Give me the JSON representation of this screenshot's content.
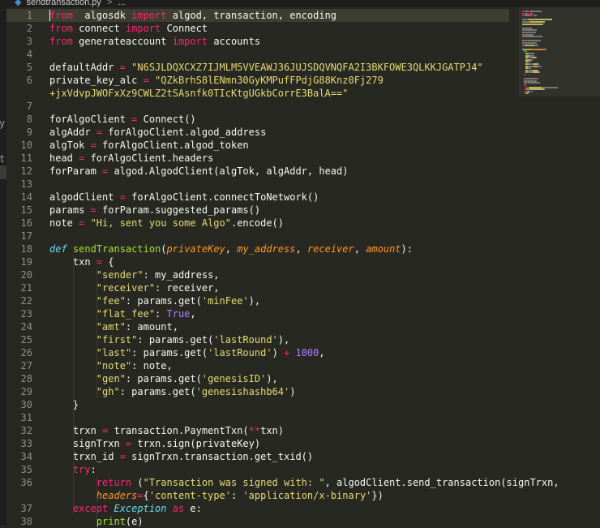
{
  "breadcrumb": {
    "file": "sendtransaction.py",
    "separator": ">",
    "ellipsis": "..."
  },
  "sidebar": {
    "fragments": [
      "y",
      "t"
    ]
  },
  "colors": {
    "background": "#272822",
    "keyword": "#f92672",
    "string": "#e6db74",
    "number": "#ae81ff",
    "function": "#a6e22e",
    "storage": "#66d9ef",
    "parameter": "#fd971f",
    "text": "#f8f8f2",
    "line_number": "#90908a"
  },
  "editor": {
    "lines": [
      {
        "n": "1",
        "t": [
          [
            "kw",
            "from"
          ],
          [
            "",
            "  algosdk "
          ],
          [
            "kw",
            "import"
          ],
          [
            "",
            " algod, transaction, encoding"
          ]
        ]
      },
      {
        "n": "2",
        "t": [
          [
            "kw",
            "from"
          ],
          [
            "",
            " connect "
          ],
          [
            "kw",
            "import"
          ],
          [
            "",
            " Connect"
          ]
        ]
      },
      {
        "n": "3",
        "t": [
          [
            "kw",
            "from"
          ],
          [
            "",
            " generateaccount "
          ],
          [
            "kw",
            "import"
          ],
          [
            "",
            " accounts"
          ]
        ]
      },
      {
        "n": "4",
        "t": []
      },
      {
        "n": "5",
        "t": [
          [
            "",
            "defaultAddr "
          ],
          [
            "kw",
            "="
          ],
          [
            " str",
            " \"N6SJLDQXCXZ7IJMLM5VVEAWJ36JUJSDQVNQFA2I3BKFOWE3QLKKJGATPJ4\""
          ]
        ]
      },
      {
        "n": "6",
        "t": [
          [
            "",
            "private_key_alc "
          ],
          [
            "kw",
            "="
          ],
          [
            "str",
            " \"QZkBrhS8lENmn30GyKMPufFPdjG88Knz0Fj279"
          ]
        ]
      },
      {
        "n": "",
        "t": [
          [
            "str",
            "+jxVdvpJWOFxXz9CWLZ2tSAsnfk0TIcKtgUGkbCorrE3BalA==\""
          ]
        ]
      },
      {
        "n": "7",
        "t": []
      },
      {
        "n": "8",
        "t": [
          [
            "",
            "forAlgoClient "
          ],
          [
            "kw",
            "="
          ],
          [
            "",
            " Connect()"
          ]
        ]
      },
      {
        "n": "9",
        "t": [
          [
            "",
            "algAddr "
          ],
          [
            "kw",
            "="
          ],
          [
            "",
            " forAlgoClient.algod_address"
          ]
        ]
      },
      {
        "n": "10",
        "t": [
          [
            "",
            "algTok "
          ],
          [
            "kw",
            "="
          ],
          [
            "",
            " forAlgoClient.algod_token"
          ]
        ]
      },
      {
        "n": "11",
        "t": [
          [
            "",
            "head "
          ],
          [
            "kw",
            "="
          ],
          [
            "",
            " forAlgoClient.headers"
          ]
        ]
      },
      {
        "n": "12",
        "t": [
          [
            "",
            "forParam "
          ],
          [
            "kw",
            "="
          ],
          [
            "",
            " algod.AlgodClient(algTok, algAddr, head)"
          ]
        ]
      },
      {
        "n": "13",
        "t": []
      },
      {
        "n": "14",
        "t": [
          [
            "",
            "algodClient "
          ],
          [
            "kw",
            "="
          ],
          [
            "",
            " forAlgoClient.connectToNetwork()"
          ]
        ]
      },
      {
        "n": "15",
        "t": [
          [
            "",
            "params "
          ],
          [
            "kw",
            "="
          ],
          [
            "",
            " forParam.suggested_params()"
          ]
        ]
      },
      {
        "n": "16",
        "t": [
          [
            "",
            "note "
          ],
          [
            "kw",
            "="
          ],
          [
            "str",
            " \"Hi, sent you some Algo\""
          ],
          [
            "",
            ".encode()"
          ]
        ]
      },
      {
        "n": "17",
        "t": []
      },
      {
        "n": "18",
        "t": [
          [
            "sto",
            "def"
          ],
          [
            "",
            " "
          ],
          [
            "fn",
            "sendTransaction"
          ],
          [
            "",
            "("
          ],
          [
            "prm",
            "privateKey"
          ],
          [
            "",
            ", "
          ],
          [
            "prm",
            "my_address"
          ],
          [
            "",
            ", "
          ],
          [
            "prm",
            "receiver"
          ],
          [
            "",
            ", "
          ],
          [
            "prm",
            "amount"
          ],
          [
            "",
            "):"
          ]
        ]
      },
      {
        "n": "19",
        "t": [
          [
            "",
            "    txn "
          ],
          [
            "kw",
            "="
          ],
          [
            "",
            " {"
          ]
        ]
      },
      {
        "n": "20",
        "t": [
          [
            "str",
            "        \"sender\""
          ],
          [
            "",
            ": my_address,"
          ]
        ]
      },
      {
        "n": "21",
        "t": [
          [
            "str",
            "        \"receiver\""
          ],
          [
            "",
            ": receiver,"
          ]
        ]
      },
      {
        "n": "22",
        "t": [
          [
            "str",
            "        \"fee\""
          ],
          [
            "",
            ": params.get("
          ],
          [
            "str",
            "'minFee'"
          ],
          [
            "",
            "),"
          ]
        ]
      },
      {
        "n": "23",
        "t": [
          [
            "str",
            "        \"flat_fee\""
          ],
          [
            "",
            ": "
          ],
          [
            "cnst",
            "True"
          ],
          [
            "",
            ","
          ]
        ]
      },
      {
        "n": "24",
        "t": [
          [
            "str",
            "        \"amt\""
          ],
          [
            "",
            ": amount,"
          ]
        ]
      },
      {
        "n": "25",
        "t": [
          [
            "str",
            "        \"first\""
          ],
          [
            "",
            ": params.get("
          ],
          [
            "str",
            "'lastRound'"
          ],
          [
            "",
            "),"
          ]
        ]
      },
      {
        "n": "26",
        "t": [
          [
            "str",
            "        \"last\""
          ],
          [
            "",
            ": params.get("
          ],
          [
            "str",
            "'lastRound'"
          ],
          [
            "",
            ") "
          ],
          [
            "kw",
            "+"
          ],
          [
            "num",
            " 1000"
          ],
          [
            "",
            ","
          ]
        ]
      },
      {
        "n": "27",
        "t": [
          [
            "str",
            "        \"note\""
          ],
          [
            "",
            ": note,"
          ]
        ]
      },
      {
        "n": "28",
        "t": [
          [
            "str",
            "        \"gen\""
          ],
          [
            "",
            ": params.get("
          ],
          [
            "str",
            "'genesisID'"
          ],
          [
            "",
            "),"
          ]
        ]
      },
      {
        "n": "29",
        "t": [
          [
            "str",
            "        \"gh\""
          ],
          [
            "",
            ": params.get("
          ],
          [
            "str",
            "'genesishashb64'"
          ],
          [
            "",
            ")"
          ]
        ]
      },
      {
        "n": "30",
        "t": [
          [
            "",
            "    }"
          ]
        ]
      },
      {
        "n": "31",
        "t": []
      },
      {
        "n": "32",
        "t": [
          [
            "",
            "    trxn "
          ],
          [
            "kw",
            "="
          ],
          [
            "",
            " transaction.PaymentTxn("
          ],
          [
            "kw",
            "**"
          ],
          [
            "",
            "txn)"
          ]
        ]
      },
      {
        "n": "33",
        "t": [
          [
            "",
            "    signTrxn "
          ],
          [
            "kw",
            "="
          ],
          [
            "",
            " trxn.sign(privateKey)"
          ]
        ]
      },
      {
        "n": "34",
        "t": [
          [
            "",
            "    trxn_id "
          ],
          [
            "kw",
            "="
          ],
          [
            "",
            " signTrxn.transaction.get_txid()"
          ]
        ]
      },
      {
        "n": "35",
        "t": [
          [
            "kw",
            "    try"
          ],
          [
            "",
            ":"
          ]
        ]
      },
      {
        "n": "36",
        "t": [
          [
            "kw",
            "        return"
          ],
          [
            "",
            " ("
          ],
          [
            "str",
            "\"Transaction was signed with: \""
          ],
          [
            "",
            ", algodClient.send_transaction(signTrxn,"
          ]
        ]
      },
      {
        "n": "",
        "t": [
          [
            "prm",
            "        headers"
          ],
          [
            "kw",
            "="
          ],
          [
            "",
            "{"
          ],
          [
            "str",
            "'content-type'"
          ],
          [
            "",
            ": "
          ],
          [
            "str",
            "'application/x-binary'"
          ],
          [
            "",
            "})"
          ]
        ]
      },
      {
        "n": "37",
        "t": [
          [
            "kw",
            "    except"
          ],
          [
            "",
            " "
          ],
          [
            "cls",
            "Exception"
          ],
          [
            "",
            " "
          ],
          [
            "kw",
            "as"
          ],
          [
            "",
            " e:"
          ]
        ]
      },
      {
        "n": "38",
        "t": [
          [
            "",
            "        "
          ],
          [
            "fn",
            "print"
          ],
          [
            "",
            "(e)"
          ]
        ]
      }
    ]
  }
}
